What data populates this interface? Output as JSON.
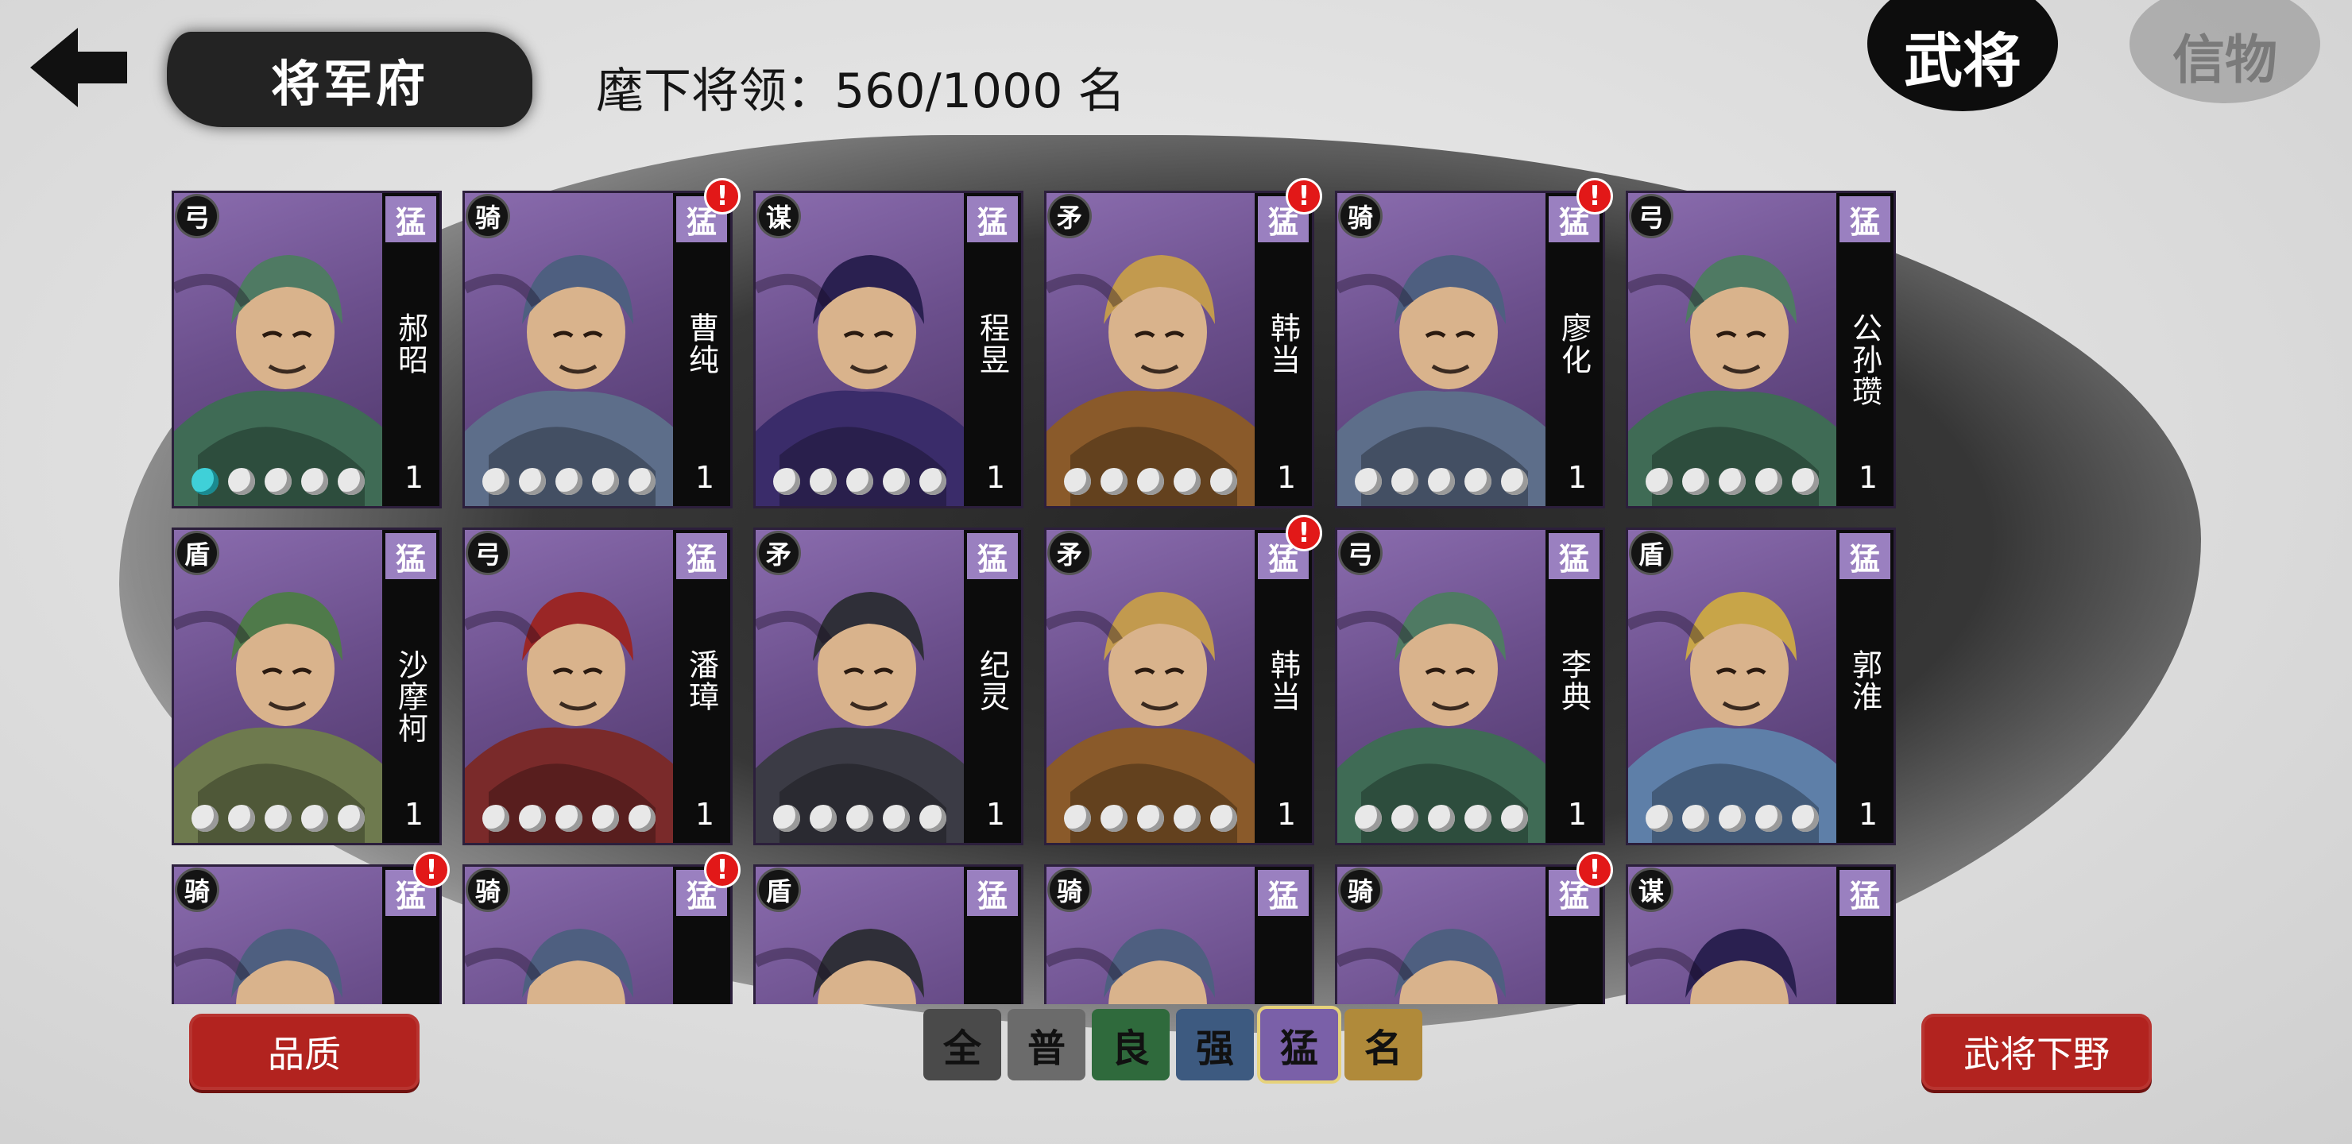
{
  "header": {
    "title": "将军府",
    "count_label": "麾下将领：",
    "count_value": "560/1000",
    "count_unit": "名"
  },
  "tabs": {
    "generals": "武将",
    "tokens": "信物"
  },
  "cards": [
    {
      "type": "弓",
      "grade": "猛",
      "name": "郝昭",
      "level": "1",
      "alert": false,
      "stars_on": 1,
      "art": "archer"
    },
    {
      "type": "骑",
      "grade": "猛",
      "name": "曹纯",
      "level": "1",
      "alert": true,
      "stars_on": 0,
      "art": "rider"
    },
    {
      "type": "谋",
      "grade": "猛",
      "name": "程昱",
      "level": "1",
      "alert": false,
      "stars_on": 0,
      "art": "strategist"
    },
    {
      "type": "矛",
      "grade": "猛",
      "name": "韩当",
      "level": "1",
      "alert": true,
      "stars_on": 0,
      "art": "elder"
    },
    {
      "type": "骑",
      "grade": "猛",
      "name": "廖化",
      "level": "1",
      "alert": true,
      "stars_on": 0,
      "art": "rider"
    },
    {
      "type": "弓",
      "grade": "猛",
      "name": "公孙瓒",
      "level": "1",
      "alert": false,
      "stars_on": 0,
      "art": "archer"
    },
    {
      "type": "盾",
      "grade": "猛",
      "name": "沙摩柯",
      "level": "1",
      "alert": false,
      "stars_on": 0,
      "art": "barbarian"
    },
    {
      "type": "弓",
      "grade": "猛",
      "name": "潘璋",
      "level": "1",
      "alert": false,
      "stars_on": 0,
      "art": "bandit"
    },
    {
      "type": "矛",
      "grade": "猛",
      "name": "纪灵",
      "level": "1",
      "alert": false,
      "stars_on": 0,
      "art": "dark"
    },
    {
      "type": "矛",
      "grade": "猛",
      "name": "韩当",
      "level": "1",
      "alert": true,
      "stars_on": 0,
      "art": "elder"
    },
    {
      "type": "弓",
      "grade": "猛",
      "name": "李典",
      "level": "1",
      "alert": false,
      "stars_on": 0,
      "art": "archer"
    },
    {
      "type": "盾",
      "grade": "猛",
      "name": "郭淮",
      "level": "1",
      "alert": false,
      "stars_on": 0,
      "art": "blue"
    },
    {
      "type": "骑",
      "grade": "猛",
      "name": "",
      "level": "",
      "alert": true,
      "stars_on": 0,
      "art": "rider"
    },
    {
      "type": "骑",
      "grade": "猛",
      "name": "",
      "level": "",
      "alert": true,
      "stars_on": 0,
      "art": "rider"
    },
    {
      "type": "盾",
      "grade": "猛",
      "name": "",
      "level": "",
      "alert": false,
      "stars_on": 0,
      "art": "dark"
    },
    {
      "type": "骑",
      "grade": "猛",
      "name": "",
      "level": "",
      "alert": false,
      "stars_on": 0,
      "art": "rider"
    },
    {
      "type": "骑",
      "grade": "猛",
      "name": "",
      "level": "",
      "alert": true,
      "stars_on": 0,
      "art": "rider"
    },
    {
      "type": "谋",
      "grade": "猛",
      "name": "",
      "level": "",
      "alert": false,
      "stars_on": 0,
      "art": "strategist"
    }
  ],
  "buttons": {
    "quality": "品质",
    "dismiss": "武将下野"
  },
  "filters": [
    {
      "label": "全",
      "color": "#4a4a4a"
    },
    {
      "label": "普",
      "color": "#6b6b6b"
    },
    {
      "label": "良",
      "color": "#2f6a3c"
    },
    {
      "label": "强",
      "color": "#3d5a80"
    },
    {
      "label": "猛",
      "color": "#7a60a8"
    },
    {
      "label": "名",
      "color": "#b08a3a"
    }
  ],
  "colors": {
    "accent_red": "#b2231f",
    "card_purple": "#6b4f8c",
    "alert_red": "#e21818"
  },
  "icons": {
    "back": "back-arrow-icon"
  }
}
